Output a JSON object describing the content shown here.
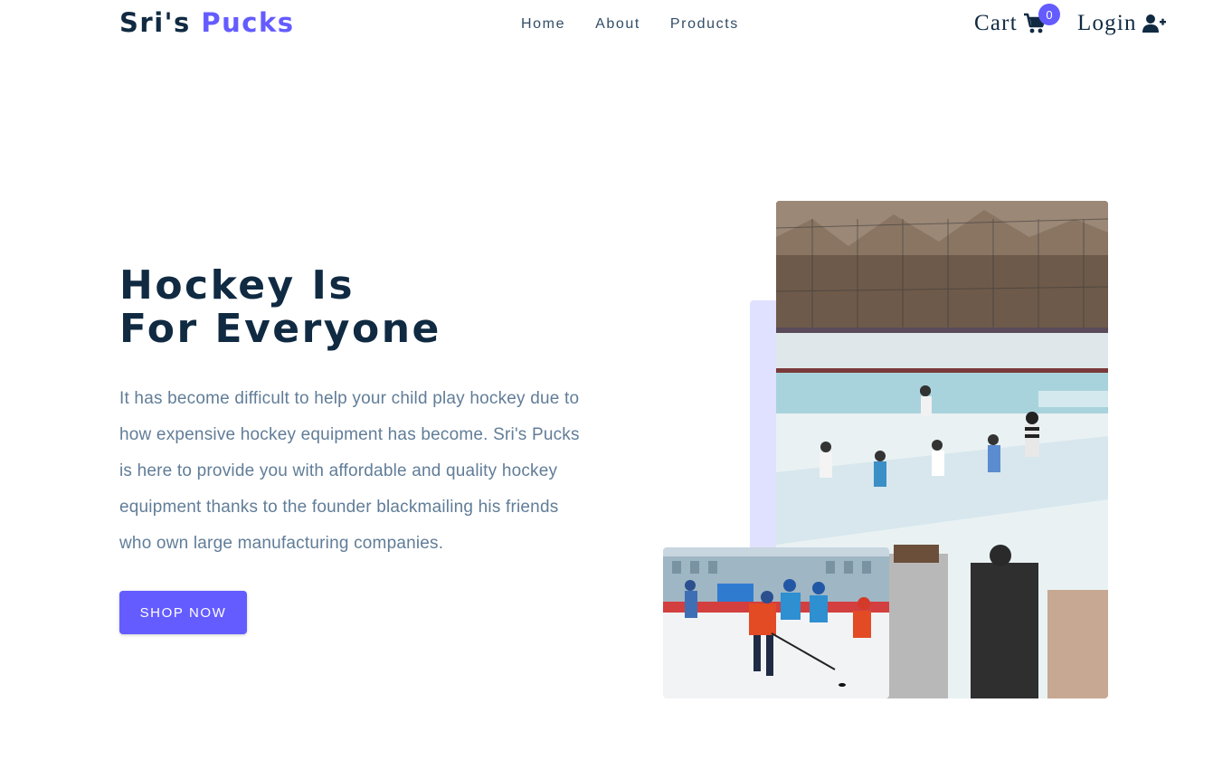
{
  "nav": {
    "logo_main": "Sri's",
    "logo_accent": "Pucks",
    "links": [
      {
        "label": "Home"
      },
      {
        "label": "About"
      },
      {
        "label": "Products"
      }
    ],
    "cart_label": "Cart",
    "cart_count": "0",
    "login_label": "Login"
  },
  "hero": {
    "title_line1": "Hockey Is",
    "title_line2": "For Everyone",
    "text": "It has become difficult to help your child play hockey due to how expensive hockey equipment has become. Sri's Pucks is here to provide you with affordable and quality hockey equipment thanks to the founder blackmailing his friends who own large manufacturing companies.",
    "button_label": "Shop Now"
  },
  "colors": {
    "accent": "#645cff",
    "accent_light": "#e0e1ff",
    "heading": "#102a42",
    "body_text": "#617d98"
  },
  "icons": {
    "cart": "shopping-cart-icon",
    "login": "user-plus-icon"
  }
}
